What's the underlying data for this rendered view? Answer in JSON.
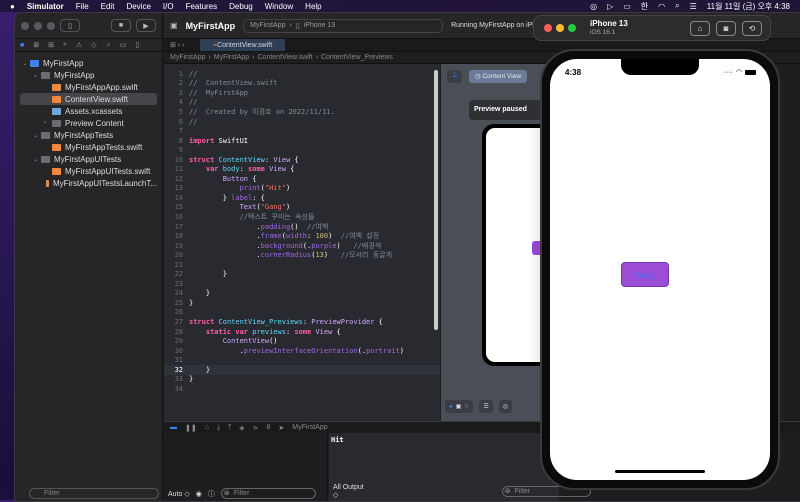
{
  "menubar": {
    "app": "Simulator",
    "items": [
      "File",
      "Edit",
      "Device",
      "I/O",
      "Features",
      "Debug",
      "Window",
      "Help"
    ],
    "clock": "11월 11일 (금) 오후 4:38",
    "input_method": "한"
  },
  "xcode": {
    "project_title": "MyFirstApp",
    "scheme": "MyFirstApp",
    "destination": "iPhone 13",
    "status": "Running MyFirstApp on iPh",
    "tab": "ContentView.swift",
    "jumpbar": [
      "MyFirstApp",
      "MyFirstApp",
      "ContentView.swift",
      "ContentView_Previews"
    ],
    "navigator": [
      {
        "label": "MyFirstApp",
        "level": 0,
        "kind": "project",
        "chev": "⌄"
      },
      {
        "label": "MyFirstApp",
        "level": 1,
        "kind": "folder",
        "chev": "⌄"
      },
      {
        "label": "MyFirstAppApp.swift",
        "level": 2,
        "kind": "swift",
        "chev": ""
      },
      {
        "label": "ContentView.swift",
        "level": 2,
        "kind": "swift",
        "chev": "",
        "selected": true
      },
      {
        "label": "Assets.xcassets",
        "level": 2,
        "kind": "assets",
        "chev": ""
      },
      {
        "label": "Preview Content",
        "level": 2,
        "kind": "folder",
        "chev": "›"
      },
      {
        "label": "MyFirstAppTests",
        "level": 1,
        "kind": "folder",
        "chev": "⌄"
      },
      {
        "label": "MyFirstAppTests.swift",
        "level": 2,
        "kind": "swift",
        "chev": ""
      },
      {
        "label": "MyFirstAppUITests",
        "level": 1,
        "kind": "folder",
        "chev": "⌄"
      },
      {
        "label": "MyFirstAppUITests.swift",
        "level": 2,
        "kind": "swift",
        "chev": ""
      },
      {
        "label": "MyFirstAppUITestsLaunchT...",
        "level": 2,
        "kind": "swift",
        "chev": ""
      }
    ],
    "nav_filter_placeholder": "Filter",
    "current_line": 32,
    "code": [
      [
        [
          "com",
          "//"
        ]
      ],
      [
        [
          "com",
          "//  ContentView.swift"
        ]
      ],
      [
        [
          "com",
          "//  MyFirstApp"
        ]
      ],
      [
        [
          "com",
          "//"
        ]
      ],
      [
        [
          "com",
          "//  Created by 이경호 on 2022/11/11."
        ]
      ],
      [
        [
          "com",
          "//"
        ]
      ],
      [],
      [
        [
          "kw",
          "import"
        ],
        [
          "pl",
          " SwiftUI"
        ]
      ],
      [],
      [
        [
          "kw",
          "struct"
        ],
        [
          "pl",
          " "
        ],
        [
          "dec",
          "ContentView"
        ],
        [
          "pl",
          ": "
        ],
        [
          "ty",
          "View"
        ],
        [
          "pl",
          " {"
        ]
      ],
      [
        [
          "pl",
          "    "
        ],
        [
          "kw",
          "var"
        ],
        [
          "pl",
          " "
        ],
        [
          "dec",
          "body"
        ],
        [
          "pl",
          ": "
        ],
        [
          "kw",
          "some"
        ],
        [
          "pl",
          " "
        ],
        [
          "ty",
          "View"
        ],
        [
          "pl",
          " {"
        ]
      ],
      [
        [
          "pl",
          "        "
        ],
        [
          "ty",
          "Button"
        ],
        [
          "pl",
          " {"
        ]
      ],
      [
        [
          "pl",
          "            "
        ],
        [
          "fn",
          "print"
        ],
        [
          "pl",
          "("
        ],
        [
          "str",
          "\"Hit\""
        ],
        [
          "pl",
          ")"
        ]
      ],
      [
        [
          "pl",
          "        } "
        ],
        [
          "fn",
          "label"
        ],
        [
          "pl",
          ": {"
        ]
      ],
      [
        [
          "pl",
          "            "
        ],
        [
          "ty",
          "Text"
        ],
        [
          "pl",
          "("
        ],
        [
          "str",
          "\"Gang\""
        ],
        [
          "pl",
          ")"
        ]
      ],
      [
        [
          "pl",
          "            "
        ],
        [
          "com",
          "//텍스트 꾸미는 속성들"
        ]
      ],
      [
        [
          "pl",
          "                ."
        ],
        [
          "fn",
          "padding"
        ],
        [
          "pl",
          "()  "
        ],
        [
          "com",
          "//여백"
        ]
      ],
      [
        [
          "pl",
          "                ."
        ],
        [
          "fn",
          "frame"
        ],
        [
          "pl",
          "("
        ],
        [
          "fn",
          "width"
        ],
        [
          "pl",
          ": "
        ],
        [
          "num",
          "100"
        ],
        [
          "pl",
          ")  "
        ],
        [
          "com",
          "//여백 설정"
        ]
      ],
      [
        [
          "pl",
          "                ."
        ],
        [
          "fn",
          "background"
        ],
        [
          "pl",
          "(."
        ],
        [
          "fn",
          "purple"
        ],
        [
          "pl",
          ")   "
        ],
        [
          "com",
          "//배경색"
        ]
      ],
      [
        [
          "pl",
          "                ."
        ],
        [
          "fn",
          "cornerRadius"
        ],
        [
          "pl",
          "("
        ],
        [
          "num",
          "13"
        ],
        [
          "pl",
          ")   "
        ],
        [
          "com",
          "//모서리 둥글게"
        ]
      ],
      [],
      [
        [
          "pl",
          "        }"
        ]
      ],
      [],
      [
        [
          "pl",
          "    }"
        ]
      ],
      [
        [
          "pl",
          "}"
        ]
      ],
      [],
      [
        [
          "kw",
          "struct"
        ],
        [
          "pl",
          " "
        ],
        [
          "dec",
          "ContentView_Previews"
        ],
        [
          "pl",
          ": "
        ],
        [
          "ty",
          "PreviewProvider"
        ],
        [
          "pl",
          " {"
        ]
      ],
      [
        [
          "pl",
          "    "
        ],
        [
          "kw",
          "static var"
        ],
        [
          "pl",
          " "
        ],
        [
          "dec",
          "previews"
        ],
        [
          "pl",
          ": "
        ],
        [
          "kw",
          "some"
        ],
        [
          "pl",
          " "
        ],
        [
          "ty",
          "View"
        ],
        [
          "pl",
          " {"
        ]
      ],
      [
        [
          "pl",
          "        "
        ],
        [
          "ty",
          "ContentView"
        ],
        [
          "pl",
          "()"
        ]
      ],
      [
        [
          "pl",
          "            ."
        ],
        [
          "fn",
          "previewInterfaceOrientation"
        ],
        [
          "pl",
          "(."
        ],
        [
          "fn",
          "portrait"
        ],
        [
          "pl",
          ")"
        ]
      ],
      [],
      [
        [
          "pl",
          "    }"
        ]
      ],
      [
        [
          "pl",
          "}"
        ]
      ],
      []
    ],
    "canvas": {
      "content_view_label": "Content View",
      "paused_label": "Preview paused"
    },
    "debug": {
      "target": "MyFirstApp",
      "console_output": "Hit",
      "auto_label": "Auto ◇",
      "all_output_label": "All Output ◇",
      "filter_placeholder": "Filter"
    }
  },
  "simulator": {
    "device": "iPhone 13",
    "os": "iOS 16.1",
    "status_time": "4:38",
    "button_label": "Gang",
    "button_color": "#9b4dd6",
    "text_color": "#4b6cf0"
  }
}
